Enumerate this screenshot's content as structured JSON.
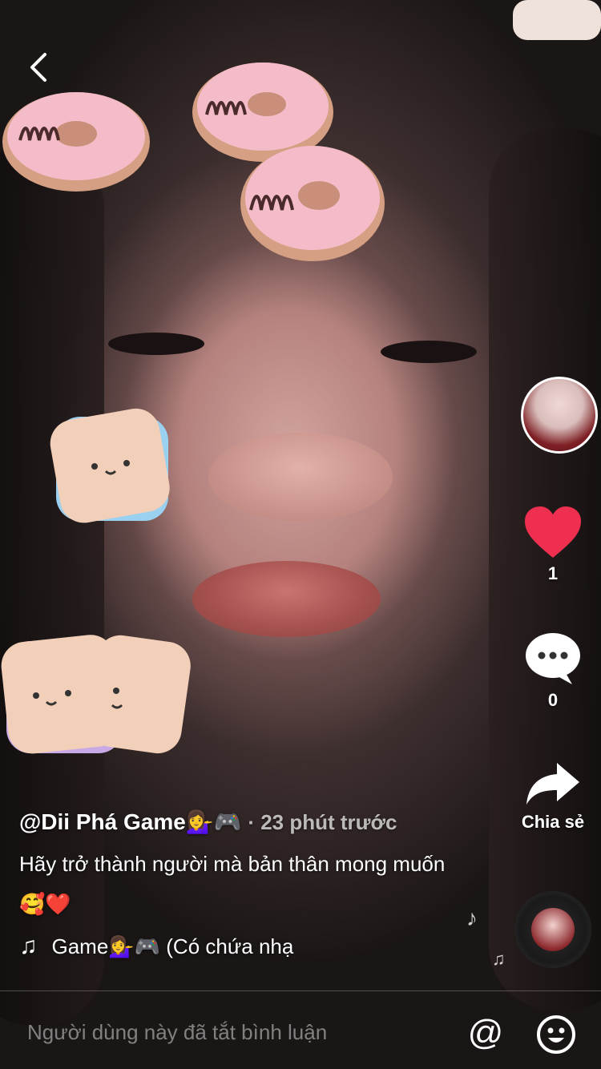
{
  "icons": {
    "back": "chevron-left-icon",
    "like": "heart-icon",
    "comment": "comment-bubble-icon",
    "share": "share-arrow-icon",
    "music": "music-note-icon",
    "mention": "at-sign-icon",
    "emoji": "smiley-icon"
  },
  "colors": {
    "like": "#ee2f4f",
    "text": "#ffffff",
    "muted": "#b8b8b8"
  },
  "rail": {
    "like_count": "1",
    "comment_count": "0",
    "share_label": "Chia sẻ"
  },
  "post": {
    "author": "@Dii Phá Game💁‍♀️🎮",
    "time": "· 23 phút trước",
    "caption": "Hãy trở thành người mà bản thân mong muốn🥰❤️",
    "music": "Game💁‍♀️🎮 (Có chứa nhạ"
  },
  "comment_bar": {
    "placeholder": "Người dùng này đã tắt bình luận"
  }
}
